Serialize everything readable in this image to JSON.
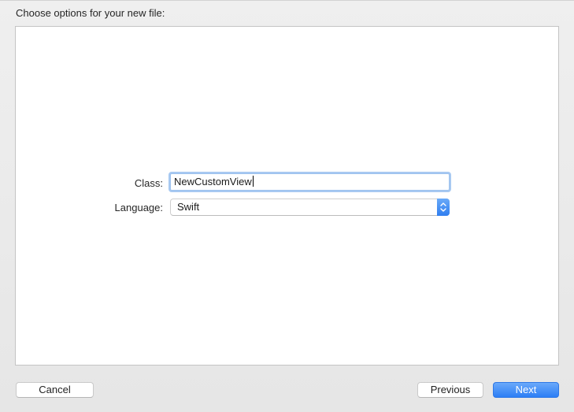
{
  "dialog": {
    "heading": "Choose options for your new file:"
  },
  "form": {
    "class_label": "Class:",
    "class_value": "NewCustomView",
    "language_label": "Language:",
    "language_value": "Swift"
  },
  "buttons": {
    "cancel": "Cancel",
    "previous": "Previous",
    "next": "Next"
  },
  "icons": {
    "language_select_arrows": "up-down-chevron-icon"
  },
  "colors": {
    "accent": "#2c7ef5",
    "focus_ring": "#a8c9f1"
  }
}
